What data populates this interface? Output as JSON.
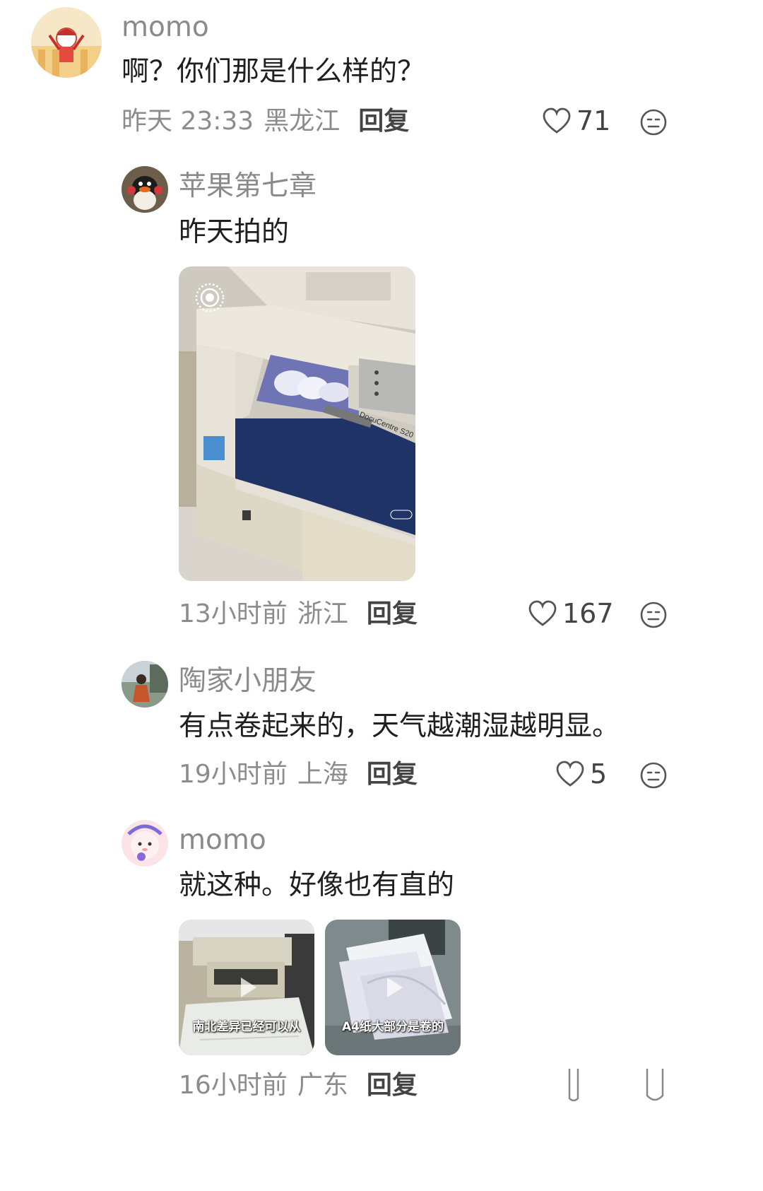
{
  "comments": [
    {
      "user": "momo",
      "text": "啊？你们那是什么样的？",
      "time": "昨天 23:33",
      "location": "黑龙江",
      "reply_label": "回复",
      "likes": "71"
    },
    {
      "user": "苹果第七章",
      "text": "昨天拍的",
      "photo_brand": "DocuCentre S20",
      "time": "13小时前",
      "location": "浙江",
      "reply_label": "回复",
      "likes": "167"
    },
    {
      "user": "陶家小朋友",
      "text": "有点卷起来的，天气越潮湿越明显。",
      "time": "19小时前",
      "location": "上海",
      "reply_label": "回复",
      "likes": "5"
    },
    {
      "user": "momo",
      "text": "就这种。好像也有直的",
      "videos": [
        {
          "caption": "南北差异已经可以从"
        },
        {
          "caption": "A4纸大部分是卷的"
        }
      ],
      "time": "16小时前",
      "location": "广东",
      "reply_label": "回复"
    }
  ],
  "icons": {
    "like": "heart-outline-icon",
    "dislike": "neutral-face-icon",
    "live_photo": "live-photo-icon",
    "play": "play-icon"
  },
  "colors": {
    "meta_gray": "#8c8c8c",
    "username_gray": "#8a8a8a",
    "text": "#1f1f1f"
  }
}
